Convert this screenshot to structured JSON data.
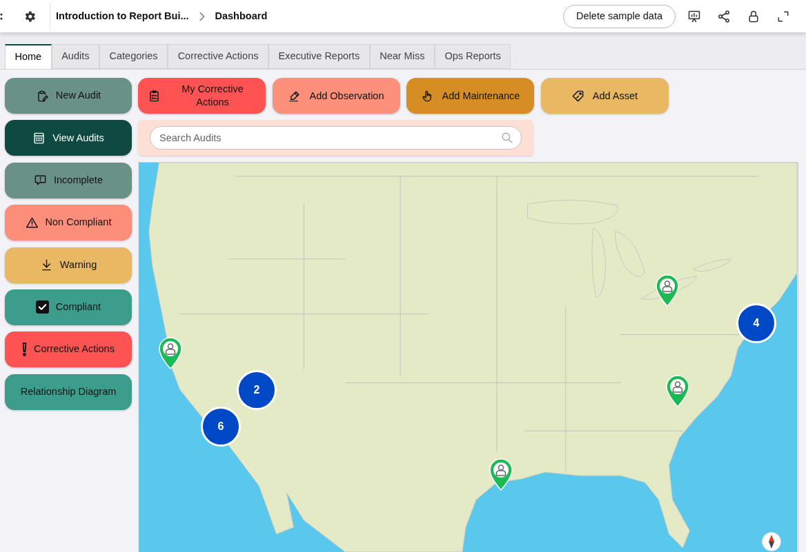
{
  "header": {
    "title": "Introduction to Report Bui...",
    "page": "Dashboard",
    "action_button": "Delete sample data"
  },
  "tabs": [
    {
      "label": "Home",
      "selected": true
    },
    {
      "label": "Audits",
      "selected": false
    },
    {
      "label": "Categories",
      "selected": false
    },
    {
      "label": "Corrective Actions",
      "selected": false
    },
    {
      "label": "Executive Reports",
      "selected": false
    },
    {
      "label": "Near Miss",
      "selected": false
    },
    {
      "label": "Ops Reports",
      "selected": false
    }
  ],
  "side_buttons": [
    {
      "label": "New Audit",
      "color": "#6a9186"
    },
    {
      "label": "View Audits",
      "color": "#0e4a42"
    },
    {
      "label": "Incomplete",
      "color": "#6a9186"
    },
    {
      "label": "Non Compliant",
      "color": "#fd8f7a"
    },
    {
      "label": "Warning",
      "color": "#e8b962"
    },
    {
      "label": "Compliant",
      "color": "#3d9d8d"
    },
    {
      "label": "Corrective Actions",
      "color": "#fd5453"
    },
    {
      "label": "Relationship Diagram",
      "color": "#3d9d8d"
    }
  ],
  "action_buttons": [
    {
      "label": "My Corrective Actions",
      "color": "#fd5453"
    },
    {
      "label": "Add Observation",
      "color": "#fd907a"
    },
    {
      "label": "Add Maintenance",
      "color": "#d68d24"
    },
    {
      "label": "Add Asset",
      "color": "#e8b962"
    }
  ],
  "search": {
    "placeholder": "Search Audits"
  },
  "map": {
    "markers": [
      {
        "kind": "pin"
      },
      {
        "kind": "cluster",
        "count": "4"
      },
      {
        "kind": "pin"
      },
      {
        "kind": "cluster",
        "count": "2"
      },
      {
        "kind": "pin"
      },
      {
        "kind": "cluster",
        "count": "6"
      },
      {
        "kind": "pin"
      }
    ]
  }
}
